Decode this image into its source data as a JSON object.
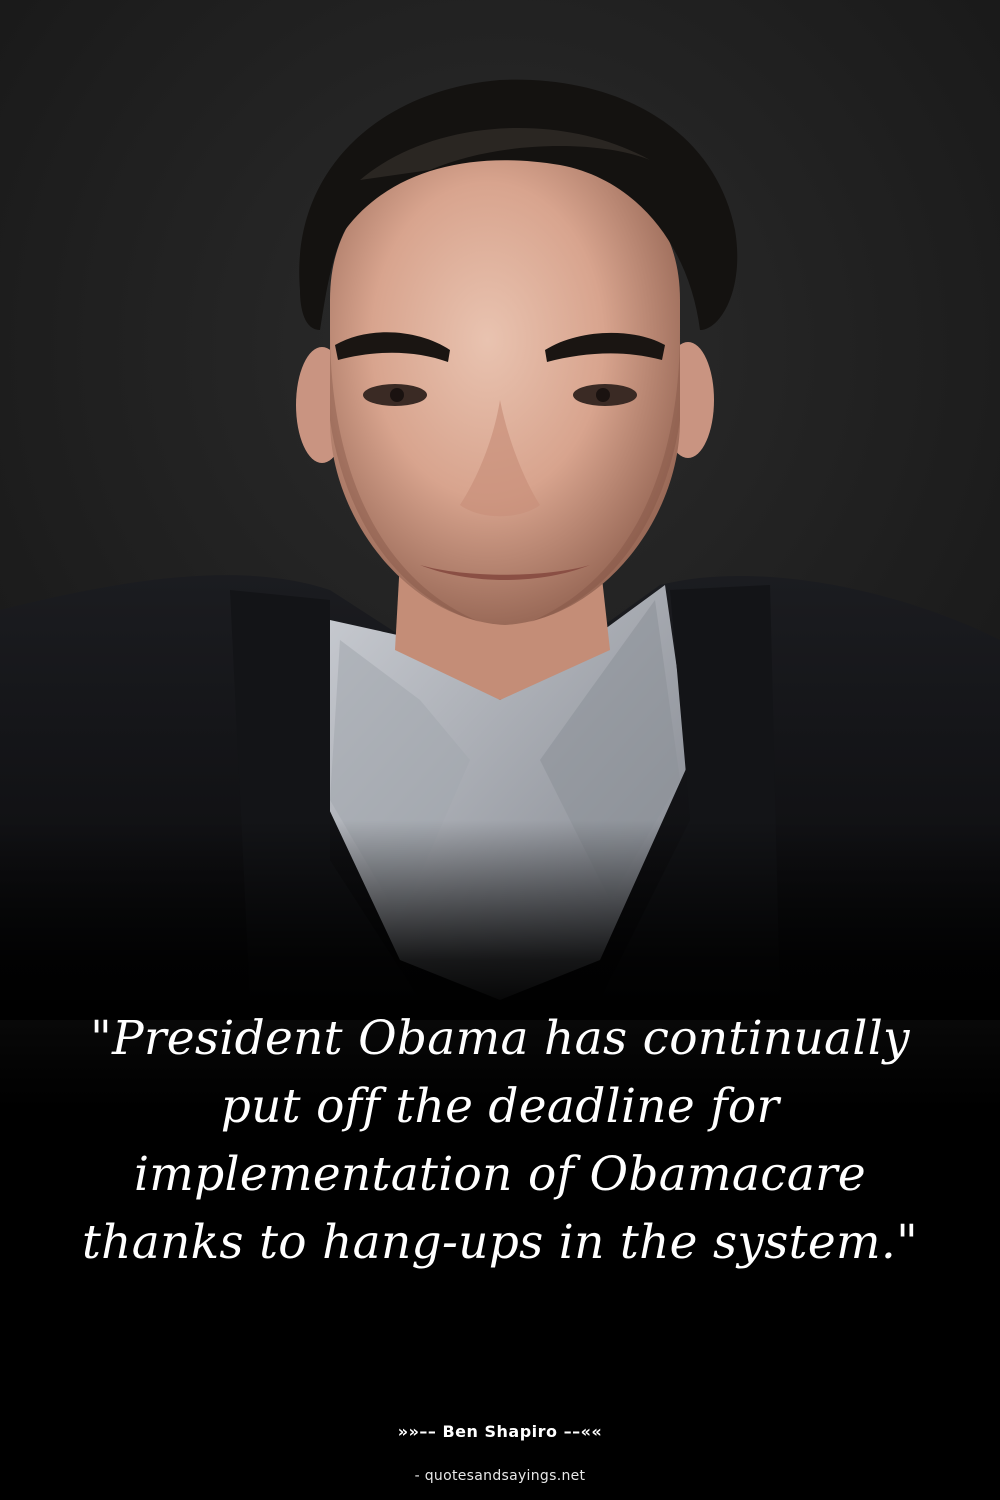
{
  "quote": {
    "text": "\"President Obama has continually put off the deadline for implementation of Obamacare thanks to hang-ups in the system.\"",
    "author": "»»–– Ben Shapiro ––««",
    "source": "- quotesandsayings.net"
  },
  "colors": {
    "background": "#000000",
    "text": "#ffffff"
  }
}
